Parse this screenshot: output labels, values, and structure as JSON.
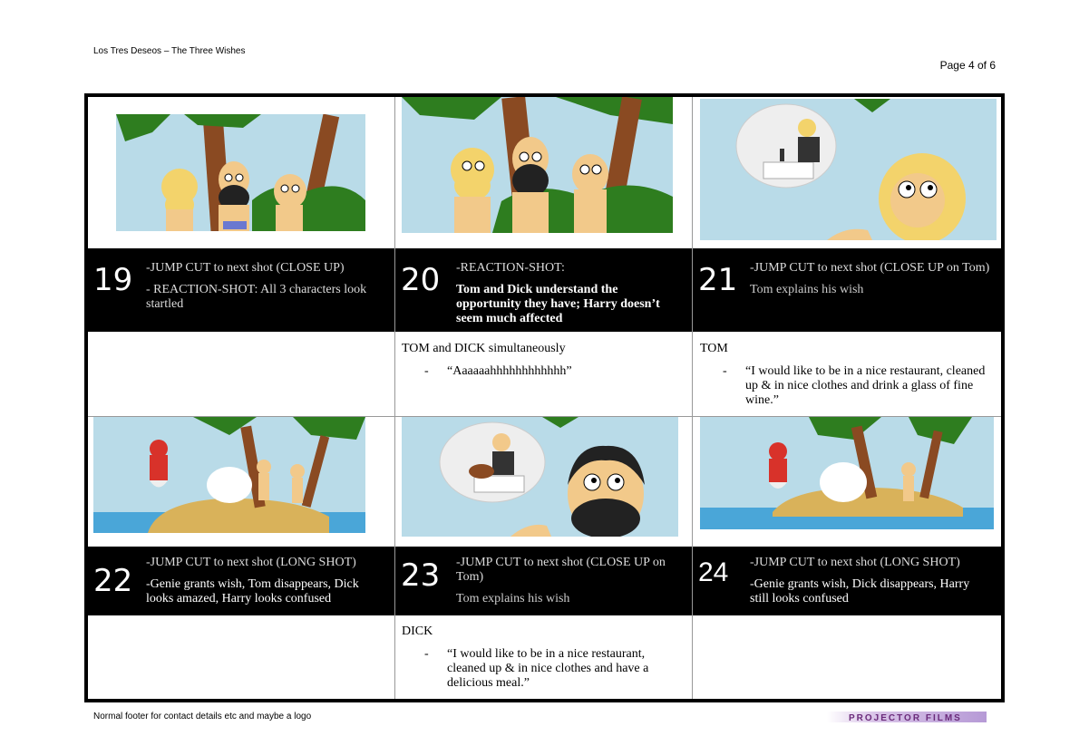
{
  "header": {
    "title": "Los Tres Deseos – The Three Wishes",
    "page": "Page 4 of 6"
  },
  "shots": [
    {
      "num": "19",
      "lines": [
        "-JUMP CUT to next shot (CLOSE UP)",
        "- REACTION-SHOT: All 3 characters look startled"
      ]
    },
    {
      "num": "20",
      "lines": [
        "-REACTION-SHOT:",
        "Tom and Dick understand the opportunity they have; Harry doesn’t seem much affected"
      ]
    },
    {
      "num": "21",
      "lines": [
        "-JUMP CUT to next shot (CLOSE UP on Tom)",
        "Tom explains his wish"
      ]
    },
    {
      "num": "22",
      "lines": [
        "-JUMP CUT to next shot (LONG SHOT)",
        "-Genie grants wish, Tom disappears, Dick looks amazed, Harry looks confused"
      ]
    },
    {
      "num": "23",
      "lines": [
        "-JUMP CUT to next shot (CLOSE UP on Tom)",
        "Tom explains his wish"
      ]
    },
    {
      "num": "24",
      "lines": [
        "-JUMP CUT to next shot (LONG SHOT)",
        "-Genie grants wish, Dick disappears, Harry still looks confused"
      ]
    }
  ],
  "dialogs": {
    "shot20": {
      "speaker": "TOM and DICK simultaneously",
      "dash": "-",
      "line": "“Aaaaaahhhhhhhhhhhh”"
    },
    "shot21": {
      "speaker": "TOM",
      "dash": "-",
      "line": "“I would like to be in a nice restaurant, cleaned up & in nice clothes and drink a glass of fine wine.”"
    },
    "shot23": {
      "speaker": "DICK",
      "dash": "-",
      "line": "“I would like to be in a nice restaurant, cleaned up & in nice clothes and have a delicious meal.”"
    }
  },
  "footer": {
    "text": "Normal footer for contact details etc and maybe a logo",
    "logo": "PROJECTOR FILMS"
  },
  "colors": {
    "sky": "#b9dbe8",
    "sea": "#4aa6d8",
    "sand": "#d9b25a",
    "palm_trunk": "#8a4a22",
    "palm_leaf": "#2e7d1f",
    "skin": "#f2c98a",
    "hair": "#f3d36b",
    "genie": "#d8322a"
  }
}
